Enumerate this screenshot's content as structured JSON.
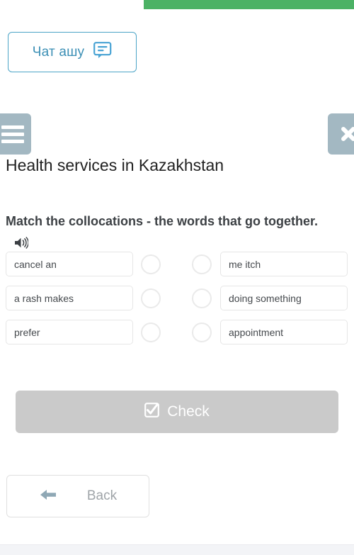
{
  "topbar": {
    "green_strip_color": "#4cb265"
  },
  "chat": {
    "label": "Чат ашу",
    "icon": "chat-bubble-icon",
    "accent_color": "#3b8fb5"
  },
  "header": {
    "menu_icon": "hamburger-icon",
    "close_icon": "close-icon",
    "button_color": "#a3b8c2",
    "lesson_title": "Health services in Kazakhstan"
  },
  "task": {
    "prompt": "Match the collocations - the words that go together.",
    "audio_icon": "speaker-icon"
  },
  "match": {
    "rows": [
      {
        "left": "cancel an",
        "right": "me itch"
      },
      {
        "left": "a rash makes",
        "right": "doing something"
      },
      {
        "left": "prefer",
        "right": "appointment"
      }
    ]
  },
  "actions": {
    "check_label": "Check",
    "check_icon": "checkbox-checked-icon",
    "check_color": "#cacaca",
    "back_label": "Back",
    "back_icon": "arrow-left-icon"
  }
}
